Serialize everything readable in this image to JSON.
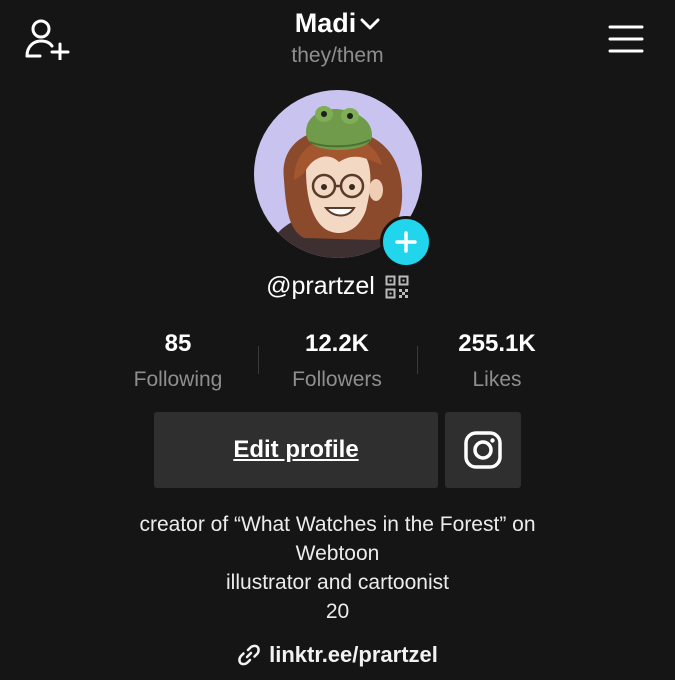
{
  "header": {
    "username": "Madi",
    "pronouns": "they/them",
    "icons": {
      "left": "add-user-icon",
      "right": "hamburger-menu-icon",
      "dropdown": "chevron-down-icon"
    }
  },
  "profile": {
    "handle": "@prartzel",
    "avatar": "illustrated-avatar-with-frog",
    "add_icon": "plus-icon",
    "qr_icon": "qr-code-icon",
    "accent_color": "#20d5ec"
  },
  "stats": [
    {
      "value": "85",
      "label": "Following"
    },
    {
      "value": "12.2K",
      "label": "Followers"
    },
    {
      "value": "255.1K",
      "label": "Likes"
    }
  ],
  "actions": {
    "edit_label": "Edit profile",
    "instagram_icon": "instagram-icon"
  },
  "bio": {
    "line1": "creator of “What Watches in the Forest” on",
    "line2": "Webtoon",
    "line3": "illustrator and cartoonist",
    "line4": "20"
  },
  "link": {
    "text": "linktr.ee/prartzel",
    "icon": "link-icon"
  }
}
